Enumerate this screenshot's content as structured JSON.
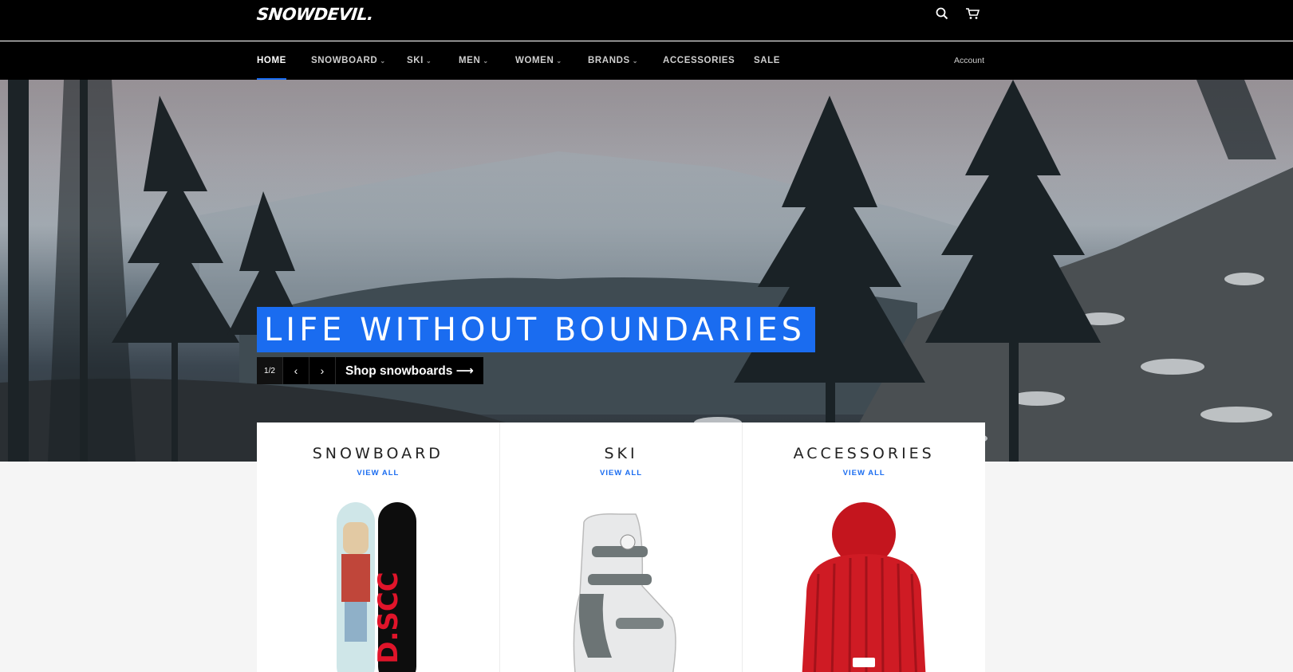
{
  "header": {
    "logo": "SNOWDEVIL.",
    "icons": [
      "search-icon",
      "cart-icon"
    ]
  },
  "nav": {
    "items": [
      {
        "label": "HOME",
        "active": true,
        "dropdown": false
      },
      {
        "label": "SNOWBOARD",
        "active": false,
        "dropdown": true
      },
      {
        "label": "SKI",
        "active": false,
        "dropdown": true
      },
      {
        "label": "MEN",
        "active": false,
        "dropdown": true
      },
      {
        "label": "WOMEN",
        "active": false,
        "dropdown": true
      },
      {
        "label": "BRANDS",
        "active": false,
        "dropdown": true
      },
      {
        "label": "ACCESSORIES",
        "active": false,
        "dropdown": false
      },
      {
        "label": "SALE",
        "active": false,
        "dropdown": false
      }
    ],
    "account": "Account"
  },
  "hero": {
    "title": "LIFE WITHOUT BOUNDARIES",
    "counter": "1/2",
    "cta": "Shop snowboards ⟶"
  },
  "collections": [
    {
      "title": "SNOWBOARD",
      "link": "VIEW ALL"
    },
    {
      "title": "SKI",
      "link": "VIEW ALL"
    },
    {
      "title": "ACCESSORIES",
      "link": "VIEW ALL"
    }
  ],
  "colors": {
    "accent": "#1a6cf0",
    "header_bg": "#000000",
    "page_bg": "#f5f5f5"
  }
}
